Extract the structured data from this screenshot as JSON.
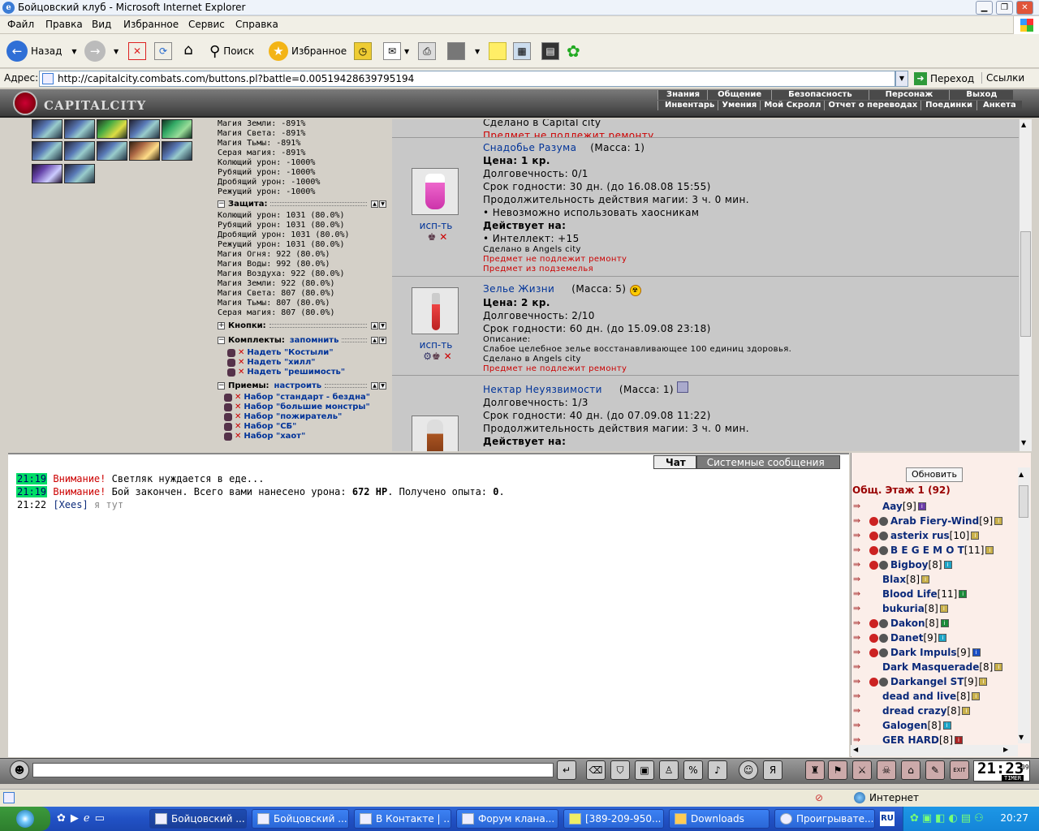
{
  "window": {
    "title": "Бойцовский клуб - Microsoft Internet Explorer"
  },
  "menu": [
    "Файл",
    "Правка",
    "Вид",
    "Избранное",
    "Сервис",
    "Справка"
  ],
  "toolbar": {
    "back": "Назад",
    "search": "Поиск",
    "favorites": "Избранное"
  },
  "address": {
    "label": "Адрес:",
    "url": "http://capitalcity.combats.com/buttons.pl?battle=0.00519428639795194",
    "go": "Переход",
    "links": "Ссылки"
  },
  "game": {
    "logo": "CAPITALCITY",
    "nav_top": [
      "Знания",
      "Общение",
      "Безопасность",
      "Персонаж",
      "Выход"
    ],
    "nav_bottom": [
      "Инвентарь",
      "Умения",
      "Мой Скролл",
      "Отчет о переводах",
      "Поединки",
      "Анкета"
    ]
  },
  "stats_attack": [
    "Магия Земли: -891%",
    "Магия Света: -891%",
    "Магия Тьмы: -891%",
    "Серая магия: -891%",
    "Колющий урон: -1000%",
    "Рубящий урон: -1000%",
    "Дробящий урон: -1000%",
    "Режущий урон: -1000%"
  ],
  "section_defense": "Защита:",
  "stats_defense": [
    "Колющий урон: 1031 (80.0%)",
    "Рубящий урон: 1031 (80.0%)",
    "Дробящий урон: 1031 (80.0%)",
    "Режущий урон: 1031 (80.0%)",
    "Магия Огня: 922 (80.0%)",
    "Магия Воды: 992 (80.0%)",
    "Магия Воздуха: 922 (80.0%)",
    "Магия Земли: 922 (80.0%)",
    "Магия Света: 807 (80.0%)",
    "Магия Тьмы: 807 (80.0%)",
    "Серая магия: 807 (80.0%)"
  ],
  "section_buttons": "Кнопки:",
  "section_sets": "Комплекты:",
  "sets_link": "запомнить",
  "sets": [
    "Надеть \"Костыли\"",
    "Надеть \"хилл\"",
    "Надеть \"решимость\""
  ],
  "section_tricks": "Приемы:",
  "tricks_link": "настроить",
  "tricks": [
    "Набор \"стандарт - бездна\"",
    "Набор \"большие монстры\"",
    "Набор \"пожиратель\"",
    "Набор \"СБ\"",
    "Набор \"хаот\""
  ],
  "items": {
    "top_partial": {
      "made": "Сделано в Capital city",
      "norepair": "Предмет не подлежит ремонту"
    },
    "item1": {
      "name": "Снадобье Разума",
      "mass": "(Масса: 1)",
      "price": "Цена: 1 кр.",
      "dur": "Долговечность: 0/1",
      "exp": "Срок годности: 30 дн. (до 16.08.08 15:55)",
      "dur_magic": "Продолжительность действия магии: 3 ч. 0 мин.",
      "restrict": "• Невозможно использовать хаосникам",
      "acts": "Действует на:",
      "bonus": "• Интеллект: +15",
      "made": "Сделано в Angels city",
      "norepair": "Предмет не подлежит ремонту",
      "from": "Предмет из подземелья",
      "use": "исп-ть"
    },
    "item2": {
      "name": "Зелье Жизни",
      "mass": "(Масса: 5)",
      "price": "Цена: 2 кр.",
      "dur": "Долговечность: 2/10",
      "exp": "Срок годности: 60 дн. (до 15.09.08 23:18)",
      "desc_label": "Описание:",
      "desc": "Слабое целебное зелье восстанавливающее 100 единиц здоровья.",
      "made": "Сделано в Angels city",
      "norepair": "Предмет не подлежит ремонту",
      "use": "исп-ть"
    },
    "item3": {
      "name": "Нектар Неуязвимости",
      "mass": "(Масса: 1)",
      "dur": "Долговечность: 1/3",
      "exp": "Срок годности: 40 дн. (до 07.09.08 11:22)",
      "dur_magic": "Продолжительность действия магии: 3 ч. 0 мин.",
      "acts": "Действует на:"
    }
  },
  "chat": {
    "tabs": [
      "Чат",
      "Системные сообщения"
    ],
    "lines": [
      {
        "time": "21:19",
        "warn": "Внимание!",
        "text": "Светляк нуждается в еде..."
      },
      {
        "time": "21:19",
        "warn": "Внимание!",
        "text_a": "Бой закончен. Всего вами нанесено урона:",
        "hp": "672 HP",
        "text_b": ". Получено опыта:",
        "exp": "0",
        "text_c": "."
      },
      {
        "time": "21:22",
        "nick": "[Xees]",
        "text": "я тут"
      }
    ]
  },
  "users": {
    "refresh": "Обновить",
    "room": "Общ. Этаж 1 (92)",
    "list": [
      {
        "name": "Aay",
        "lv": "[9]",
        "icons": 0
      },
      {
        "name": "Arab Fiery-Wind",
        "lv": "[9]",
        "icons": 2
      },
      {
        "name": "asterix rus",
        "lv": "[10]",
        "icons": 2
      },
      {
        "name": "B E G E M O T",
        "lv": "[11]",
        "icons": 2
      },
      {
        "name": "Bigboy",
        "lv": "[8]",
        "icons": 2
      },
      {
        "name": "Blax",
        "lv": "[8]",
        "icons": 0
      },
      {
        "name": "Blood Life",
        "lv": "[11]",
        "icons": 0
      },
      {
        "name": "bukuria",
        "lv": "[8]",
        "icons": 0
      },
      {
        "name": "Dakon",
        "lv": "[8]",
        "icons": 2
      },
      {
        "name": "Danet",
        "lv": "[9]",
        "icons": 2
      },
      {
        "name": "Dark Impuls",
        "lv": "[9]",
        "icons": 2
      },
      {
        "name": "Dark Masquerade",
        "lv": "[8]",
        "icons": 0
      },
      {
        "name": "Darkangel ST",
        "lv": "[9]",
        "icons": 2
      },
      {
        "name": "dead and live",
        "lv": "[8]",
        "icons": 0
      },
      {
        "name": "dread crazy",
        "lv": "[8]",
        "icons": 0
      },
      {
        "name": "Galogen",
        "lv": "[8]",
        "icons": 0
      },
      {
        "name": "GER HARD",
        "lv": "[8]",
        "icons": 0
      }
    ]
  },
  "clock": {
    "time": "21:23",
    "seconds": "09",
    "label": "TIMER"
  },
  "status": {
    "zone": "Интернет"
  },
  "taskbar": {
    "buttons": [
      "Бойцовский ...",
      "Бойцовский ...",
      "В Контакте | ...",
      "Форум клана...",
      "[389-209-950...",
      "Downloads",
      "Проигрывате..."
    ],
    "lang": "RU",
    "time": "20:27"
  }
}
